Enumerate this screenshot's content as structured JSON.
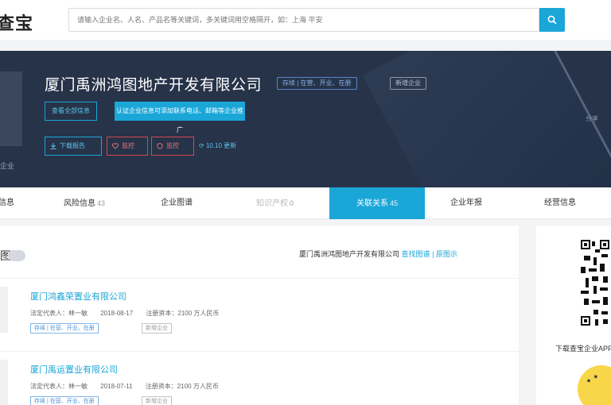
{
  "app": {
    "logo_text": "查宝"
  },
  "search": {
    "placeholder": "请输入企业名、人名、产品名等关键词，多关键词用空格隔开，如：上海 平安",
    "button_icon": "search-icon"
  },
  "company": {
    "name": "厦门禹洲鸿图地产开发有限公司",
    "tag_group": "存续 | 在营、开业、在册",
    "tag_status": "新增企业",
    "btn_primary_outline": "查看全部信息",
    "btn_primary_fill": "认证企业信息可添加联系电话、邮箱等企业推广",
    "actions": [
      {
        "label": "下载报告",
        "icon": "download-icon"
      },
      {
        "label": "监控",
        "icon": "heart-icon"
      },
      {
        "label": "监控",
        "icon": "shield-icon"
      }
    ],
    "link_text": "10.10 更新",
    "side_text": "企业",
    "right_text": "分享"
  },
  "tabs": [
    {
      "label": "信息",
      "count": ""
    },
    {
      "label": "风险信息",
      "count": "43"
    },
    {
      "label": "企业图谱",
      "count": ""
    },
    {
      "label": "知识产权",
      "count": "0"
    },
    {
      "label": "关联关系",
      "count": "45"
    },
    {
      "label": "企业年报",
      "count": ""
    },
    {
      "label": "经营信息",
      "count": ""
    }
  ],
  "section": {
    "title": "图",
    "breadcrumb_company": "厦门禹洲鸿图地产开发有限公司",
    "breadcrumb_link1": "查找图谱",
    "breadcrumb_link2": "原图示"
  },
  "results": [
    {
      "name": "厦门鸿鑫荣置业有限公司",
      "legal_rep": "法定代表人：林一敏",
      "date": "2018-08-17",
      "capital": "注册资本：2100 万人民币",
      "status_tag": "存续 | 在营、开业、在册",
      "extra_tag": "新增企业"
    },
    {
      "name": "厦门禹运置业有限公司",
      "legal_rep": "法定代表人：林一敏",
      "date": "2018-07-11",
      "capital": "注册资本：2100 万人民币",
      "status_tag": "存续 | 在营、开业、在册",
      "extra_tag": "新增企业"
    }
  ],
  "sidebar": {
    "qr_icon": "qr-code-icon",
    "caption": "下载查宝企业APP"
  },
  "colors": {
    "accent": "#1ba6d8",
    "hero_bg": "#263349",
    "danger": "#d6474d"
  }
}
